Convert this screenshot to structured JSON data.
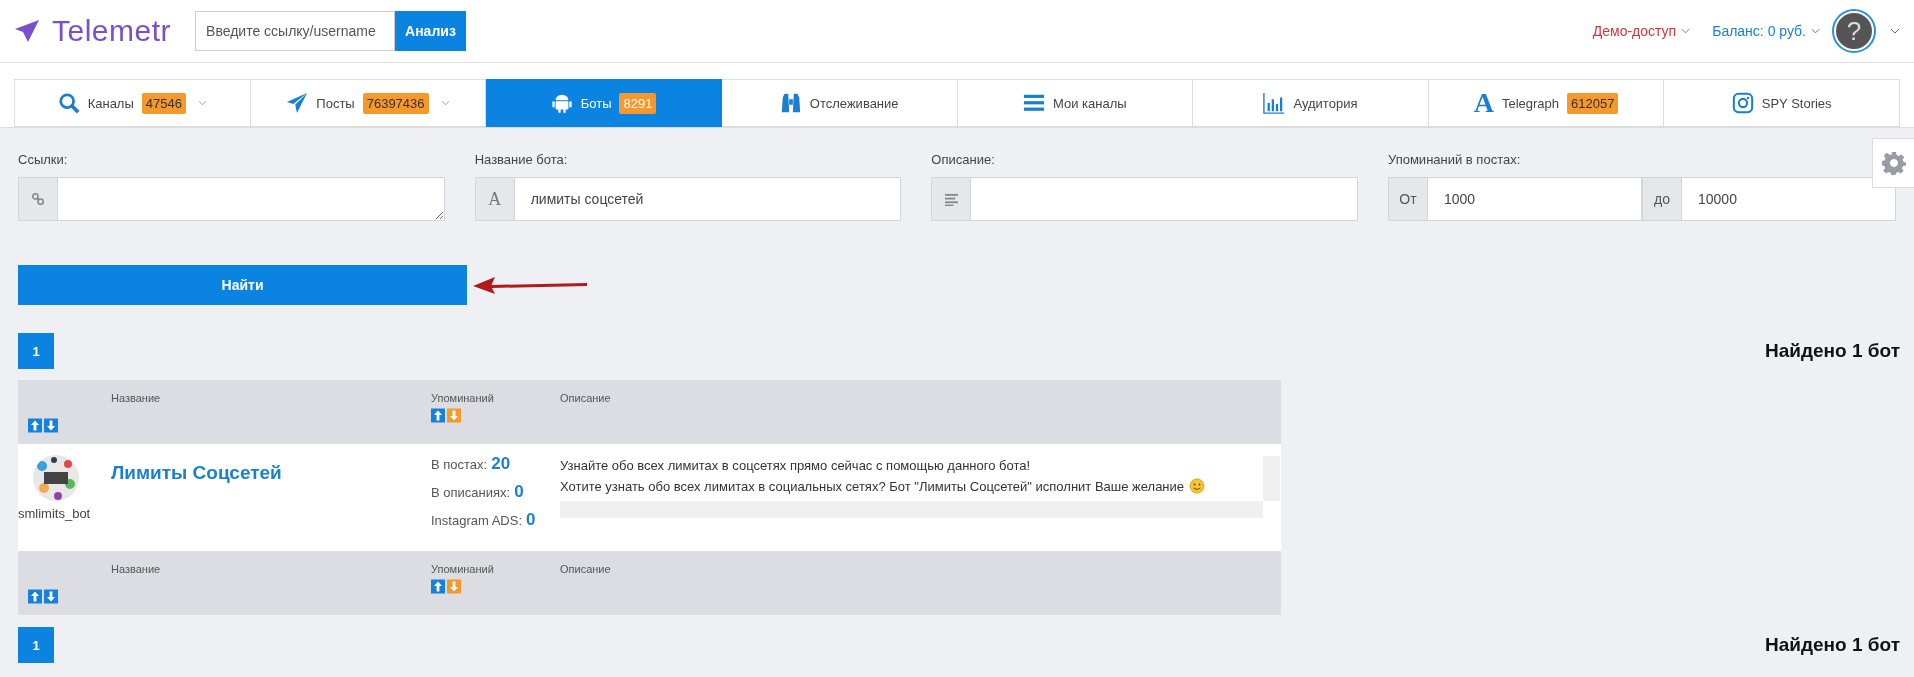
{
  "header": {
    "logo": "Telemetr",
    "search": {
      "placeholder": "Введите ссылку/username"
    },
    "search_button": "Анализ",
    "demo": "Демо-доступ",
    "balance": "Баланс: 0 руб.",
    "avatar": "?"
  },
  "tabs": [
    {
      "label": "Каналы",
      "badge": "47546",
      "dropdown": true,
      "selected": false
    },
    {
      "label": "Посты",
      "badge": "76397436",
      "dropdown": true,
      "selected": false
    },
    {
      "label": "Боты",
      "badge": "8291",
      "dropdown": false,
      "selected": true
    },
    {
      "label": "Отслеживание",
      "dropdown": false,
      "selected": false
    },
    {
      "label": "Мои каналы",
      "dropdown": false,
      "selected": false
    },
    {
      "label": "Аудитория",
      "dropdown": false,
      "selected": false
    },
    {
      "glyph": "A",
      "label": "Telegraph",
      "badge": "612057",
      "dropdown": false,
      "selected": false
    },
    {
      "label": "SPY Stories",
      "dropdown": false,
      "selected": false
    }
  ],
  "filters": {
    "links": {
      "label": "Ссылки:"
    },
    "bot_name": {
      "label": "Название бота:",
      "prefix": "A",
      "value": "лимиты соцсетей"
    },
    "description": {
      "label": "Описание:"
    },
    "mentions": {
      "label": "Упоминаний в постах:",
      "from_label": "От",
      "from_value": "1000",
      "to_label": "до",
      "to_value": "10000"
    }
  },
  "find_button": "Найти",
  "pagination_top": {
    "pages": [
      {
        "label": "1",
        "selected": true
      }
    ],
    "found": "Найдено 1 бот"
  },
  "table": {
    "header": [
      {
        "kind": "sort",
        "sorted_desc": false
      },
      {
        "kind": "label",
        "label": "Название"
      },
      {
        "kind": "sort_label",
        "label": "Упоминаний",
        "sorted_desc": true
      },
      {
        "kind": "label",
        "label": "Описание"
      }
    ],
    "rows": [
      {
        "username": "smlimits_bot",
        "name": "Лимиты Соцсетей",
        "mentions": [
          {
            "label": "В постах:",
            "value": "20"
          },
          {
            "label": "В описаниях:",
            "value": "0"
          },
          {
            "label": "Instagram ADS:",
            "value": "0"
          }
        ],
        "description": [
          "Узнайте обо всех лимитах в соцсетях прямо сейчас с помощью данного бота!",
          "Хотите узнать обо всех лимитах в социальных сетях? Бот \"Лимиты Соцсетей\" исполнит Ваше желание"
        ]
      }
    ],
    "footer": [
      {
        "kind": "sort",
        "sorted_desc": false
      },
      {
        "kind": "label",
        "label": "Название"
      },
      {
        "kind": "sort_label",
        "label": "Упоминаний",
        "sorted_desc": true
      },
      {
        "kind": "label",
        "label": "Описание"
      }
    ]
  },
  "pagination_bottom": {
    "pages": [
      {
        "label": "1",
        "selected": true
      }
    ],
    "found": "Найдено 1 бот"
  }
}
